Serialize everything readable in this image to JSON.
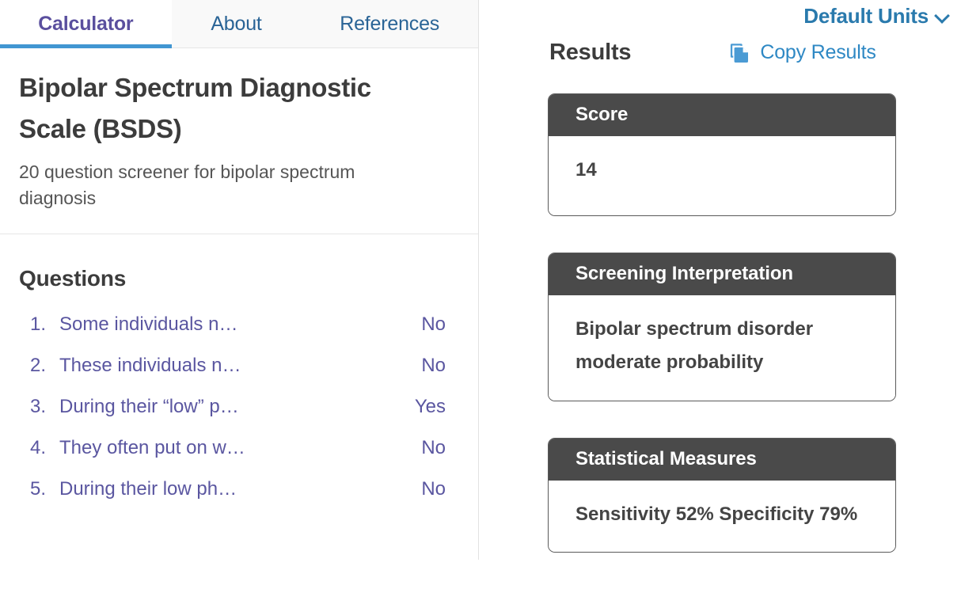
{
  "tabs": [
    {
      "label": "Calculator",
      "active": true,
      "name": "tab-calculator"
    },
    {
      "label": "About",
      "active": false,
      "name": "tab-about"
    },
    {
      "label": "References",
      "active": false,
      "name": "tab-references"
    }
  ],
  "calculator": {
    "title": "Bipolar Spectrum Diagnostic Scale (BSDS)",
    "subtitle": "20 question screener for bipolar spectrum diagnosis",
    "questions_heading": "Questions",
    "questions": [
      {
        "number": "1.",
        "text": "Some individuals n…",
        "answer": "No"
      },
      {
        "number": "2.",
        "text": "These individuals n…",
        "answer": "No"
      },
      {
        "number": "3.",
        "text": "During their “low” p…",
        "answer": "Yes"
      },
      {
        "number": "4.",
        "text": "They often put on w…",
        "answer": "No"
      },
      {
        "number": "5.",
        "text": "During their low ph…",
        "answer": "No"
      }
    ]
  },
  "results": {
    "units_label": "Default Units",
    "units_icon": "chevron-down-icon",
    "heading": "Results",
    "copy_label": "Copy Results",
    "copy_icon": "copy-icon",
    "cards": [
      {
        "title": "Score",
        "body": "14"
      },
      {
        "title": "Screening Interpretation",
        "body": "Bipolar spectrum disorder moderate probability"
      },
      {
        "title": "Statistical Measures",
        "body": "Sensitivity 52% Specificity 79%"
      }
    ]
  },
  "colors": {
    "active_tab_text": "#5a4f9e",
    "active_tab_underline": "#4196d2",
    "inactive_tab_text": "#2a6496",
    "question_text": "#5a56a0",
    "link_blue": "#2e88c4",
    "units_blue": "#2a7aad",
    "card_header_bg": "#4a4a4a",
    "heading_text": "#3c3c3c"
  }
}
